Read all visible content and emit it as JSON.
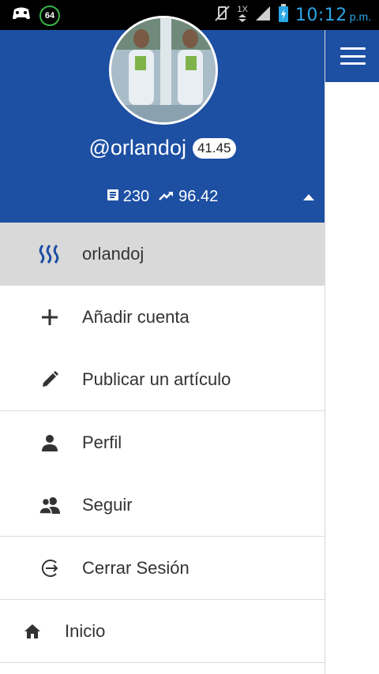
{
  "status_bar": {
    "battery_level": "64",
    "data_indicator": "1X",
    "time": "10:12",
    "ampm": "p.m."
  },
  "profile": {
    "username": "@orlandoj",
    "reputation": "41.45",
    "post_count": "230",
    "voting_power": "96.42"
  },
  "accounts": [
    {
      "label": "orlandoj",
      "icon": "steem-logo-icon"
    }
  ],
  "menu": [
    {
      "label": "Añadir cuenta",
      "icon": "plus-icon"
    },
    {
      "label": "Publicar un artículo",
      "icon": "pencil-icon"
    },
    {
      "label": "Perfil",
      "icon": "person-icon"
    },
    {
      "label": "Seguir",
      "icon": "people-icon"
    },
    {
      "label": "Cerrar Sesión",
      "icon": "logout-icon"
    }
  ],
  "nav": [
    {
      "label": "Inicio",
      "icon": "home-icon"
    }
  ],
  "colors": {
    "header_blue": "#1d4fa3",
    "active_row": "#d9d9d9",
    "clock_blue": "#2aa7e6"
  }
}
